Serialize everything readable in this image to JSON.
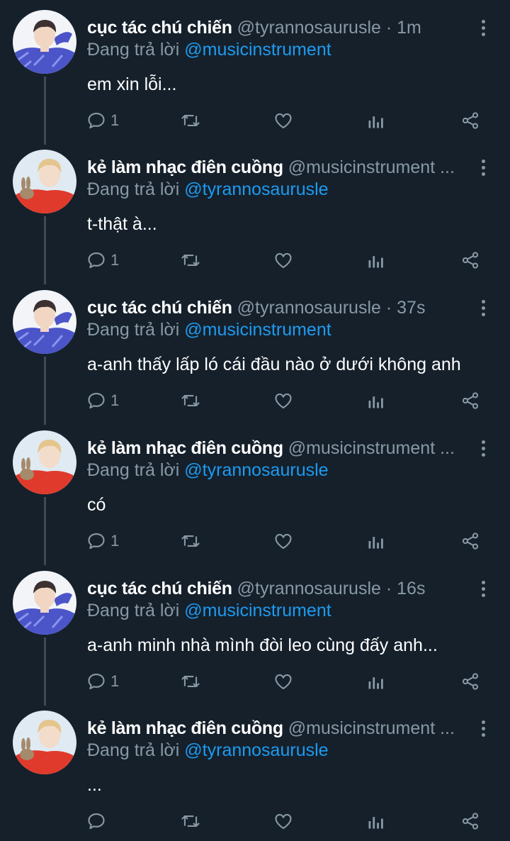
{
  "tweets": [
    {
      "display_name": "cục tác chú chiến",
      "handle": "@tyrannosaurusle",
      "time": "1m",
      "reply_prefix": "Đang trả lời",
      "reply_to": "@musicinstrument",
      "text": "em xin lỗi...",
      "reply_count": "1",
      "avatar": "blue-sweater-avatar"
    },
    {
      "display_name": "kẻ làm nhạc điên cuồng",
      "handle": "@musicinstrument ...",
      "time": "",
      "reply_prefix": "Đang trả lời",
      "reply_to": "@tyrannosaurusle",
      "text": "t-thật à...",
      "reply_count": "1",
      "avatar": "red-sweater-bunny-avatar"
    },
    {
      "display_name": "cục tác chú chiến",
      "handle": "@tyrannosaurusle",
      "time": "37s",
      "reply_prefix": "Đang trả lời",
      "reply_to": "@musicinstrument",
      "text": "a-anh thấy lấp ló cái đầu nào ở dưới không anh",
      "reply_count": "1",
      "avatar": "blue-sweater-avatar"
    },
    {
      "display_name": "kẻ làm nhạc điên cuồng",
      "handle": "@musicinstrument ...",
      "time": "",
      "reply_prefix": "Đang trả lời",
      "reply_to": "@tyrannosaurusle",
      "text": "có",
      "reply_count": "1",
      "avatar": "red-sweater-bunny-avatar"
    },
    {
      "display_name": "cục tác chú chiến",
      "handle": "@tyrannosaurusle",
      "time": "16s",
      "reply_prefix": "Đang trả lời",
      "reply_to": "@musicinstrument",
      "text": "a-anh minh nhà mình đòi leo cùng đấy anh...",
      "reply_count": "1",
      "avatar": "blue-sweater-avatar"
    },
    {
      "display_name": "kẻ làm nhạc điên cuồng",
      "handle": "@musicinstrument ...",
      "time": "",
      "reply_prefix": "Đang trả lời",
      "reply_to": "@tyrannosaurusle",
      "text": "...",
      "reply_count": "",
      "avatar": "red-sweater-bunny-avatar"
    }
  ],
  "icons": {
    "reply": "reply-icon",
    "retweet": "retweet-icon",
    "like": "heart-icon",
    "stats": "bar-chart-icon",
    "share": "share-icon",
    "more": "more-vertical-icon"
  },
  "colors": {
    "background": "#15202b",
    "text": "#ffffff",
    "secondary": "#8899a6",
    "mention": "#1d9bf0",
    "thread_line": "#3d4b59"
  }
}
